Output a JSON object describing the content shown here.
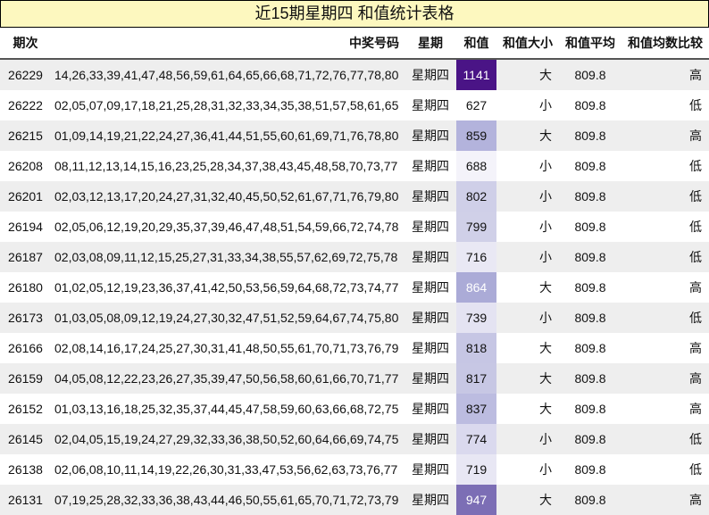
{
  "title": "近15期星期四 和值统计表格",
  "headers": {
    "issue": "期次",
    "numbers": "中奖号码",
    "weekday": "星期",
    "sum": "和值",
    "size": "和值大小",
    "avg": "和值平均",
    "compare": "和值均数比较"
  },
  "rows": [
    {
      "issue": "26229",
      "numbers": "14,26,33,39,41,47,48,56,59,61,64,65,66,68,71,72,76,77,78,80",
      "weekday": "星期四",
      "sum": "1141",
      "size": "大",
      "avg": "809.8",
      "compare": "高",
      "sum_bg": "#4a1486",
      "sum_fg": "#ffffff"
    },
    {
      "issue": "26222",
      "numbers": "02,05,07,09,17,18,21,25,28,31,32,33,34,35,38,51,57,58,61,65",
      "weekday": "星期四",
      "sum": "627",
      "size": "小",
      "avg": "809.8",
      "compare": "低",
      "sum_bg": "#ffffff",
      "sum_fg": "#111111"
    },
    {
      "issue": "26215",
      "numbers": "01,09,14,19,21,22,24,27,36,41,44,51,55,60,61,69,71,76,78,80",
      "weekday": "星期四",
      "sum": "859",
      "size": "大",
      "avg": "809.8",
      "compare": "高",
      "sum_bg": "#b3b3dc",
      "sum_fg": "#111111"
    },
    {
      "issue": "26208",
      "numbers": "08,11,12,13,14,15,16,23,25,28,34,37,38,43,45,48,58,70,73,77",
      "weekday": "星期四",
      "sum": "688",
      "size": "小",
      "avg": "809.8",
      "compare": "低",
      "sum_bg": "#f4f3fa",
      "sum_fg": "#111111"
    },
    {
      "issue": "26201",
      "numbers": "02,03,12,13,17,20,24,27,31,32,40,45,50,52,61,67,71,76,79,80",
      "weekday": "星期四",
      "sum": "802",
      "size": "小",
      "avg": "809.8",
      "compare": "低",
      "sum_bg": "#cfcfe8",
      "sum_fg": "#111111"
    },
    {
      "issue": "26194",
      "numbers": "02,05,06,12,19,20,29,35,37,39,46,47,48,51,54,59,66,72,74,78",
      "weekday": "星期四",
      "sum": "799",
      "size": "小",
      "avg": "809.8",
      "compare": "低",
      "sum_bg": "#d0d0e8",
      "sum_fg": "#111111"
    },
    {
      "issue": "26187",
      "numbers": "02,03,08,09,11,12,15,25,27,31,33,34,38,55,57,62,69,72,75,78",
      "weekday": "星期四",
      "sum": "716",
      "size": "小",
      "avg": "809.8",
      "compare": "低",
      "sum_bg": "#e9e8f4",
      "sum_fg": "#111111"
    },
    {
      "issue": "26180",
      "numbers": "01,02,05,12,19,23,36,37,41,42,50,53,56,59,64,68,72,73,74,77",
      "weekday": "星期四",
      "sum": "864",
      "size": "大",
      "avg": "809.8",
      "compare": "高",
      "sum_bg": "#ababd7",
      "sum_fg": "#ffffff"
    },
    {
      "issue": "26173",
      "numbers": "01,03,05,08,09,12,19,24,27,30,32,47,51,52,59,64,67,74,75,80",
      "weekday": "星期四",
      "sum": "739",
      "size": "小",
      "avg": "809.8",
      "compare": "低",
      "sum_bg": "#e4e3f2",
      "sum_fg": "#111111"
    },
    {
      "issue": "26166",
      "numbers": "02,08,14,16,17,24,25,27,30,31,41,48,50,55,61,70,71,73,76,79",
      "weekday": "星期四",
      "sum": "818",
      "size": "大",
      "avg": "809.8",
      "compare": "高",
      "sum_bg": "#c6c6e4",
      "sum_fg": "#111111"
    },
    {
      "issue": "26159",
      "numbers": "04,05,08,12,22,23,26,27,35,39,47,50,56,58,60,61,66,70,71,77",
      "weekday": "星期四",
      "sum": "817",
      "size": "大",
      "avg": "809.8",
      "compare": "高",
      "sum_bg": "#c7c7e4",
      "sum_fg": "#111111"
    },
    {
      "issue": "26152",
      "numbers": "01,03,13,16,18,25,32,35,37,44,45,47,58,59,60,63,66,68,72,75",
      "weekday": "星期四",
      "sum": "837",
      "size": "大",
      "avg": "809.8",
      "compare": "高",
      "sum_bg": "#bcbce0",
      "sum_fg": "#111111"
    },
    {
      "issue": "26145",
      "numbers": "02,04,05,15,19,24,27,29,32,33,36,38,50,52,60,64,66,69,74,75",
      "weekday": "星期四",
      "sum": "774",
      "size": "小",
      "avg": "809.8",
      "compare": "低",
      "sum_bg": "#dad9ee",
      "sum_fg": "#111111"
    },
    {
      "issue": "26138",
      "numbers": "02,06,08,10,11,14,19,22,26,30,31,33,47,53,56,62,63,73,76,77",
      "weekday": "星期四",
      "sum": "719",
      "size": "小",
      "avg": "809.8",
      "compare": "低",
      "sum_bg": "#e8e7f4",
      "sum_fg": "#111111"
    },
    {
      "issue": "26131",
      "numbers": "07,19,25,28,32,33,36,38,43,44,46,50,55,61,65,70,71,72,73,79",
      "weekday": "星期四",
      "sum": "947",
      "size": "大",
      "avg": "809.8",
      "compare": "高",
      "sum_bg": "#7c6eb5",
      "sum_fg": "#ffffff"
    }
  ]
}
